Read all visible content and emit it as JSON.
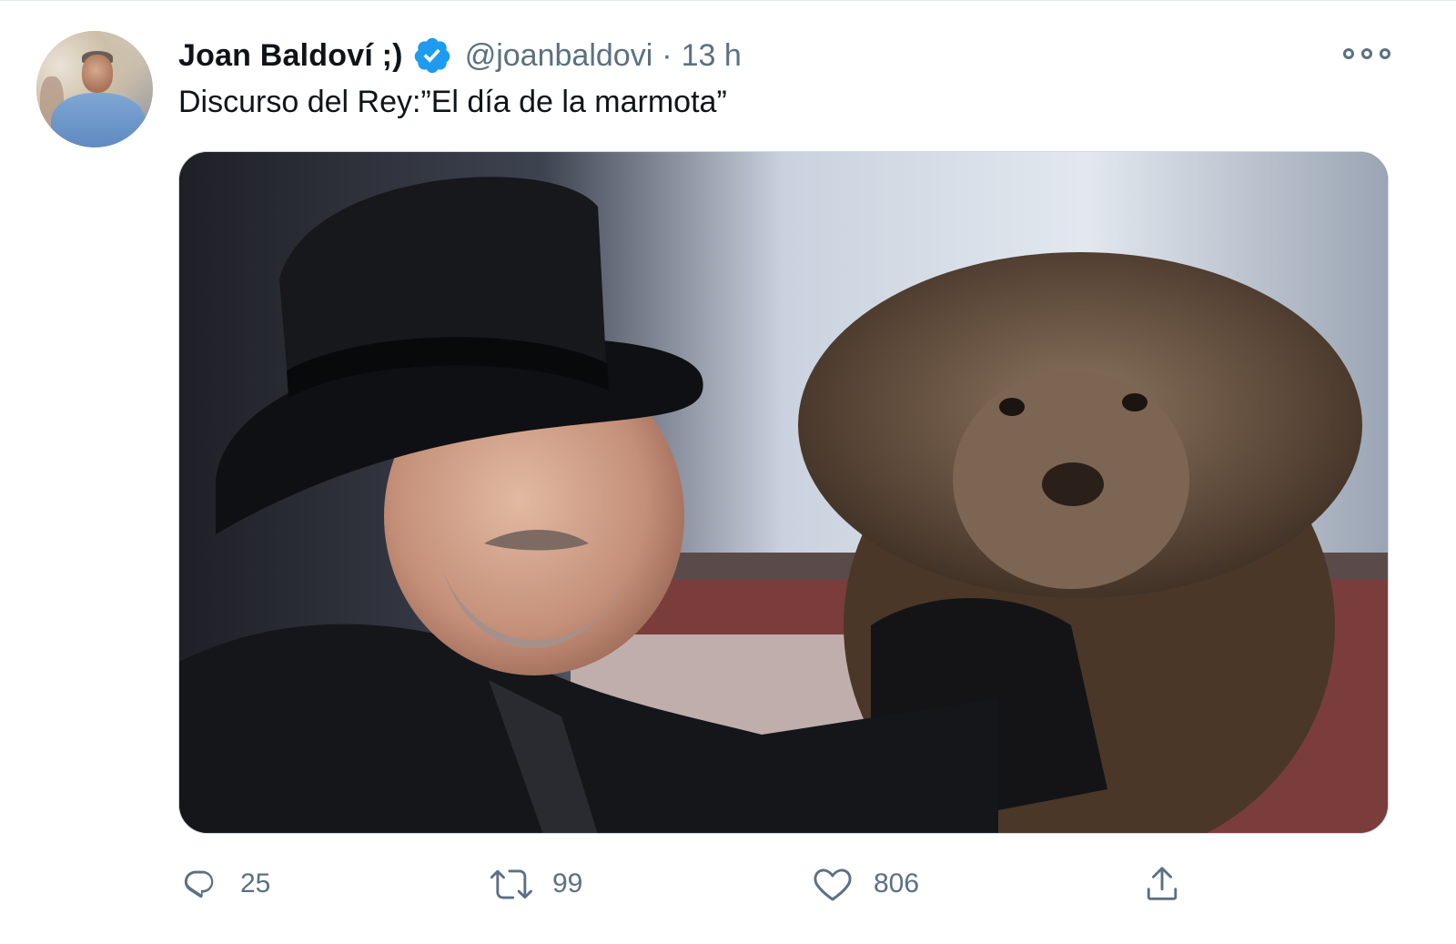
{
  "tweet": {
    "display_name": "Joan Baldoví ;)",
    "handle": "@joanbaldovi",
    "separator": "·",
    "time": "13 h",
    "text": "Discurso del Rey:”El día de la marmota”"
  },
  "actions": {
    "reply_count": "25",
    "retweet_count": "99",
    "like_count": "806"
  },
  "icons": {
    "verified": "verified-badge-icon",
    "more": "more-options-icon",
    "reply": "reply-icon",
    "retweet": "retweet-icon",
    "like": "heart-icon",
    "share": "share-icon"
  },
  "colors": {
    "verified_blue": "#1d9bf0",
    "secondary_text": "#5b7083",
    "primary_text": "#0f1419"
  }
}
